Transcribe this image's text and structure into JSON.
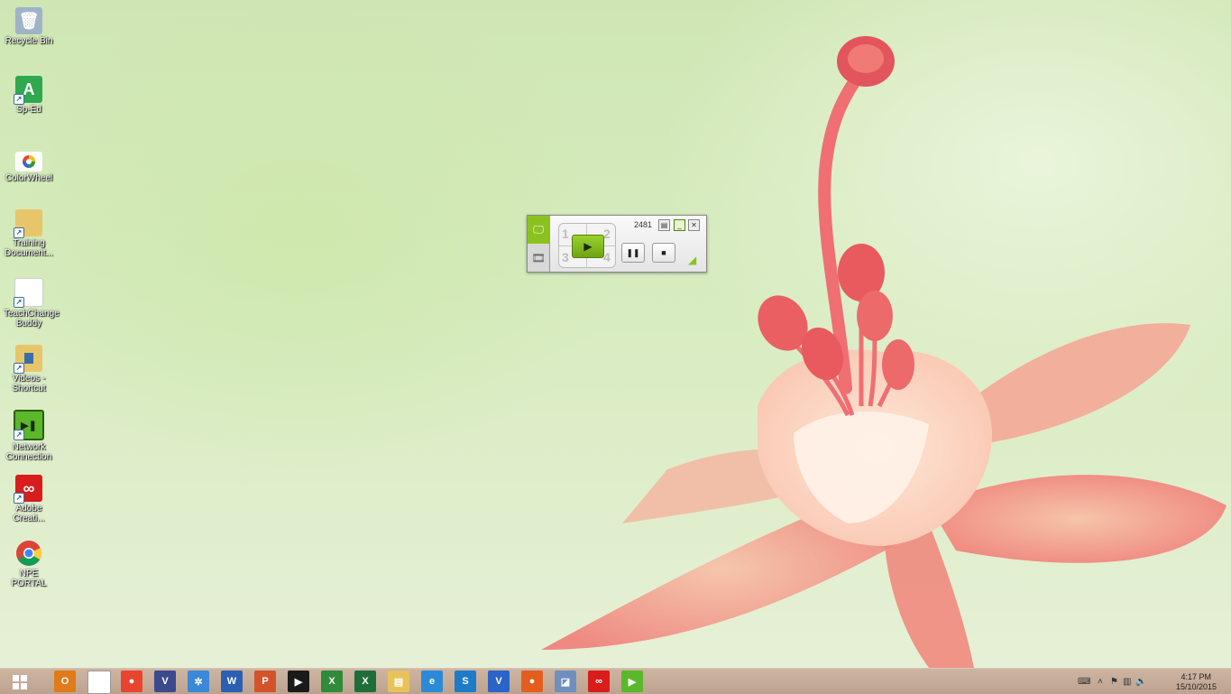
{
  "desktop": {
    "icons": [
      {
        "label": "Recycle Bin",
        "icon": "recycle-bin-icon",
        "color": "#9fb3c8",
        "glyph": "🗑"
      },
      {
        "label": "Sp-Ed",
        "icon": "app-a-icon",
        "color": "#2fa84f",
        "glyph": "A"
      },
      {
        "label": "ColorWheel",
        "icon": "color-wheel-icon",
        "color": "#ffffff",
        "glyph": "●"
      },
      {
        "label": "Training Document...",
        "icon": "folder-icon",
        "color": "#e7c66a",
        "glyph": ""
      },
      {
        "label": "TeachChange Buddy",
        "icon": "document-icon",
        "color": "#ffffff",
        "glyph": ""
      },
      {
        "label": "Videos - Shortcut",
        "icon": "videos-folder-icon",
        "color": "#e7c66a",
        "glyph": ""
      },
      {
        "label": "Network Connection",
        "icon": "network-connection-icon",
        "color": "#5ab82a",
        "glyph": "▶"
      },
      {
        "label": "Adobe Creati...",
        "icon": "adobe-creative-cloud-icon",
        "color": "#d91c1c",
        "glyph": "∞"
      },
      {
        "label": "NPE PORTAL",
        "icon": "chrome-icon",
        "color": "#f0f0f0",
        "glyph": ""
      }
    ]
  },
  "player": {
    "count": "2481",
    "grid_numbers": [
      "1",
      "2",
      "3",
      "4"
    ],
    "play_label": "▶",
    "pause_label": "❚❚",
    "stop_label": "■",
    "mode_screen": "🖵",
    "mode_film": "🎞",
    "minimize": "_",
    "close": "✕",
    "accent": "#8bc21f"
  },
  "taskbar": {
    "apps": [
      {
        "name": "outlook",
        "glyph": "O",
        "color": "#e07b1a"
      },
      {
        "name": "file",
        "glyph": "",
        "color": "#ffffff"
      },
      {
        "name": "chrome",
        "glyph": "●",
        "color": "#e8452f"
      },
      {
        "name": "vnc-viewer",
        "glyph": "V",
        "color": "#3b4a8c"
      },
      {
        "name": "settings-app",
        "glyph": "✲",
        "color": "#3a88d8"
      },
      {
        "name": "word",
        "glyph": "W",
        "color": "#2b5fb4"
      },
      {
        "name": "powerpoint",
        "glyph": "P",
        "color": "#d3532a"
      },
      {
        "name": "video-recorder",
        "glyph": "▶",
        "color": "#1a1a1a"
      },
      {
        "name": "excel-chart",
        "glyph": "X",
        "color": "#2f8a3a"
      },
      {
        "name": "excel",
        "glyph": "X",
        "color": "#1f6e3a"
      },
      {
        "name": "file-explorer",
        "glyph": "▤",
        "color": "#e7c35a"
      },
      {
        "name": "internet-explorer",
        "glyph": "e",
        "color": "#2b8ad6"
      },
      {
        "name": "skype-s",
        "glyph": "S",
        "color": "#1e7bc7"
      },
      {
        "name": "app-v",
        "glyph": "V",
        "color": "#2a64c8"
      },
      {
        "name": "firefox",
        "glyph": "●",
        "color": "#e35e1e"
      },
      {
        "name": "notes-app",
        "glyph": "◪",
        "color": "#6f8fc0"
      },
      {
        "name": "adobe-cc",
        "glyph": "∞",
        "color": "#d91c1c"
      },
      {
        "name": "network-connection",
        "glyph": "▶",
        "color": "#5ab82a"
      }
    ],
    "clock_time": "4:17 PM",
    "clock_date": "15/10/2015",
    "tray_keyboard": "⌨",
    "tray_chevron": "˄",
    "tray_flag": "⚑",
    "tray_network": "▥",
    "tray_volume": "🔈"
  }
}
